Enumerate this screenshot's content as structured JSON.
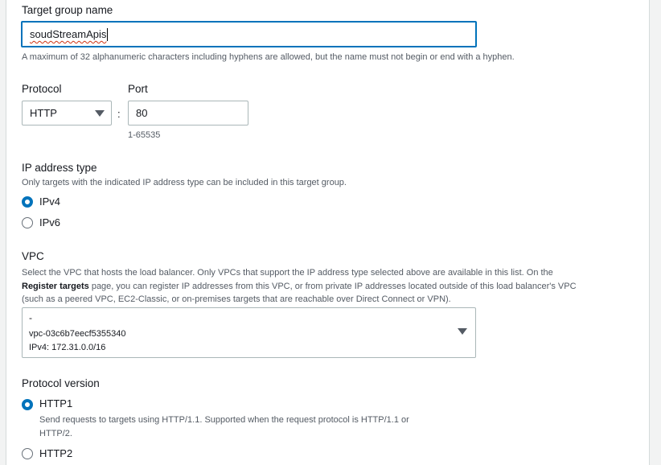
{
  "target_group_name": {
    "label": "Target group name",
    "value": "soudStreamApis",
    "hint": "A maximum of 32 alphanumeric characters including hyphens are allowed, but the name must not begin or end with a hyphen."
  },
  "protocol": {
    "label": "Protocol",
    "value": "HTTP",
    "separator": ":"
  },
  "port": {
    "label": "Port",
    "value": "80",
    "hint": "1-65535"
  },
  "ip_address_type": {
    "label": "IP address type",
    "description": "Only targets with the indicated IP address type can be included in this target group.",
    "options": [
      {
        "label": "IPv4",
        "selected": true
      },
      {
        "label": "IPv6",
        "selected": false
      }
    ]
  },
  "vpc": {
    "label": "VPC",
    "description_1": "Select the VPC that hosts the load balancer. Only VPCs that support the IP address type selected above are available in this list. On the",
    "description_bold": "Register targets",
    "description_2": " page, you can register IP addresses from this VPC, or from private IP addresses located outside of this load balancer's VPC",
    "description_3": "(such as a peered VPC, EC2-Classic, or on-premises targets that are reachable over Direct Connect or VPN).",
    "selected_name": "-",
    "selected_id": "vpc-03c6b7eecf5355340",
    "selected_cidr": "IPv4: 172.31.0.0/16"
  },
  "protocol_version": {
    "label": "Protocol version",
    "options": [
      {
        "label": "HTTP1",
        "selected": true,
        "description_1": "Send requests to targets using HTTP/1.1. Supported when the request protocol is HTTP/1.1 or",
        "description_2": "HTTP/2."
      },
      {
        "label": "HTTP2",
        "selected": false
      }
    ]
  },
  "colors": {
    "accent": "#0073bb",
    "text": "#16191f",
    "muted": "#545b64"
  }
}
